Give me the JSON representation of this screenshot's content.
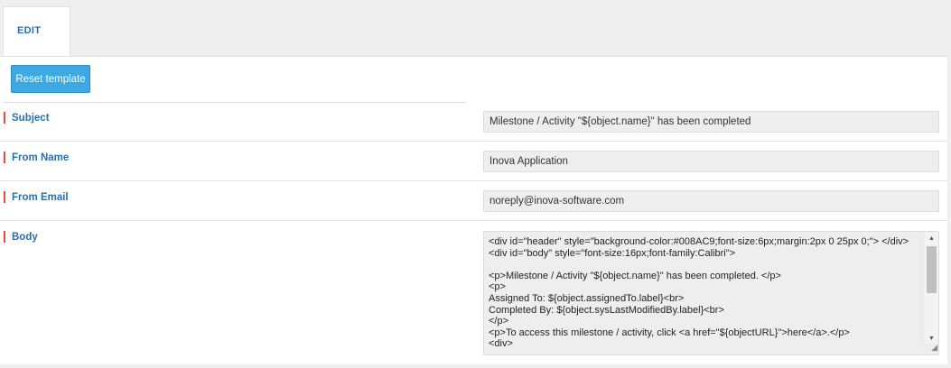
{
  "tabs": [
    {
      "label": "EDIT"
    }
  ],
  "toolbar": {
    "reset_label": "Reset template"
  },
  "form": {
    "subject": {
      "label": "Subject",
      "value": "Milestone / Activity \"${object.name}\" has been completed"
    },
    "from_name": {
      "label": "From Name",
      "value": "Inova Application"
    },
    "from_email": {
      "label": "From Email",
      "value": "noreply@inova-software.com"
    },
    "body": {
      "label": "Body",
      "value": "<div id=\"header\" style=\"background-color:#008AC9;font-size:6px;margin:2px 0 25px 0;\"> </div>\n<div id=\"body\" style=\"font-size:16px;font-family:Calibri\">\n\n<p>Milestone / Activity \"${object.name}\" has been completed. </p>\n<p>\nAssigned To: ${object.assignedTo.label}<br>\nCompleted By: ${object.sysLastModifiedBy.label}<br>\n</p>\n<p>To access this milestone / activity, click <a href=\"${objectURL}\">here</a>.</p>\n<div>"
    }
  },
  "colors": {
    "accent": "#3da9e0",
    "label": "#2a6fae",
    "required_marker": "#e74c3c"
  }
}
